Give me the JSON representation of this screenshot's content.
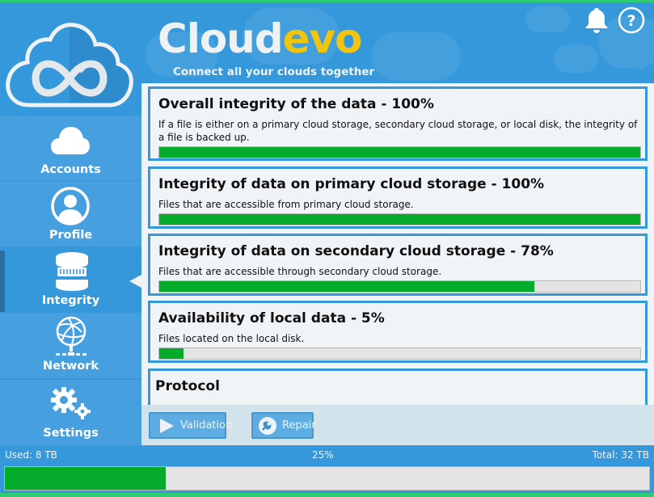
{
  "app": {
    "brand_part1": "Cloud",
    "brand_part2": "evo",
    "tagline": "Connect all your clouds together",
    "colors": {
      "primary": "#3598db",
      "accent_yellow": "#f1c40f",
      "accent_green": "#2ecc71",
      "progress_green": "#05ab2b"
    }
  },
  "header": {
    "icons": [
      {
        "name": "bell-icon",
        "label": "Notifications"
      },
      {
        "name": "help-icon",
        "label": "Help"
      }
    ]
  },
  "sidebar": {
    "active": "Integrity",
    "items": [
      {
        "label": "Accounts",
        "icon": "cloud-icon"
      },
      {
        "label": "Profile",
        "icon": "user-icon"
      },
      {
        "label": "Integrity",
        "icon": "database-icon"
      },
      {
        "label": "Network",
        "icon": "globe-network-icon"
      },
      {
        "label": "Settings",
        "icon": "gears-icon"
      }
    ]
  },
  "cards": [
    {
      "title": "Overall integrity of the data - 100%",
      "description": "If a file is either on a primary cloud storage, secondary cloud storage, or local disk, the integrity of a file is backed up.",
      "percent": 100
    },
    {
      "title": "Integrity of data on primary cloud storage - 100%",
      "description": "Files that are accessible from primary cloud storage.",
      "percent": 100
    },
    {
      "title": "Integrity of data on secondary cloud storage - 78%",
      "description": "Files that are accessible through secondary cloud storage.",
      "percent": 78
    },
    {
      "title": "Availability of local data - 5%",
      "description": "Files located on the local disk.",
      "percent": 5
    },
    {
      "title": "Protocol"
    }
  ],
  "actions": {
    "validation_label": "Validation",
    "repair_label": "Repair"
  },
  "footer": {
    "used": "Used: 8 TB",
    "percent_label": "25%",
    "total": "Total: 32 TB",
    "percent": 25
  }
}
